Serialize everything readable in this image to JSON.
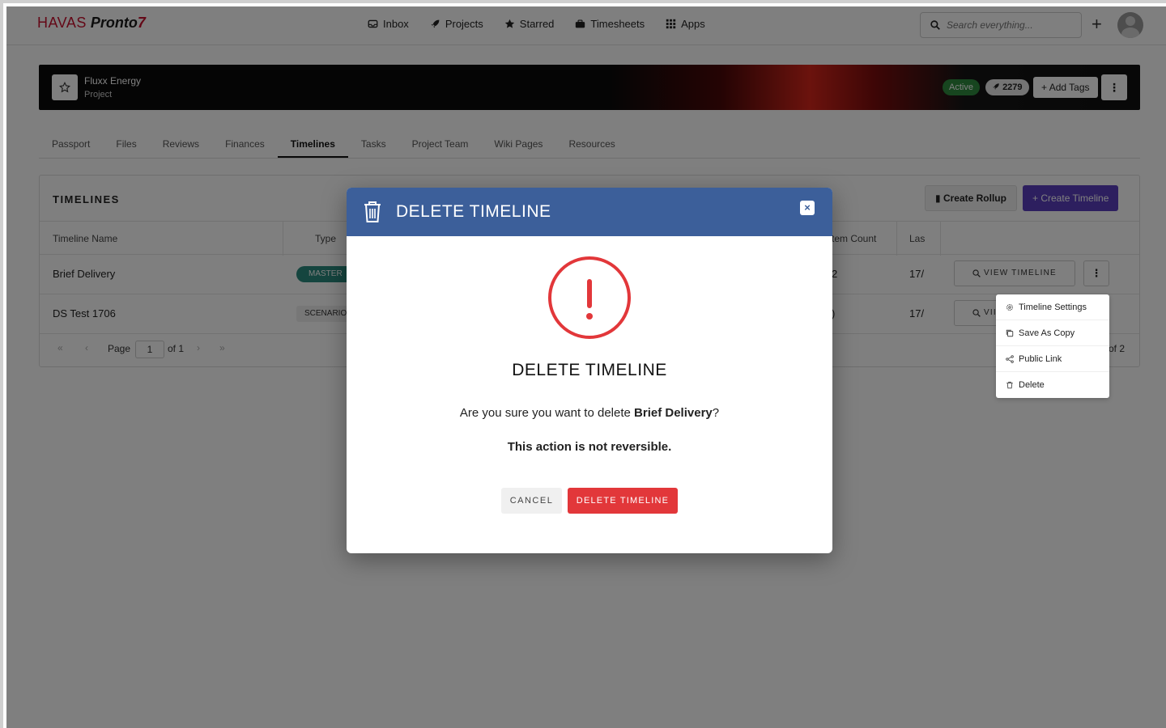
{
  "brand": {
    "havas": "HAVAS",
    "pronto": "Pronto",
    "bolt": "7"
  },
  "nav": {
    "items": [
      {
        "label": "Inbox",
        "icon": "inbox-icon"
      },
      {
        "label": "Projects",
        "icon": "rocket-icon"
      },
      {
        "label": "Starred",
        "icon": "star-icon"
      },
      {
        "label": "Timesheets",
        "icon": "briefcase-icon"
      },
      {
        "label": "Apps",
        "icon": "grid-icon"
      }
    ],
    "search_placeholder": "Search everything..."
  },
  "project": {
    "name": "Fluxx Energy",
    "type": "Project",
    "status": "Active",
    "id": "2279",
    "add_tags": "Add Tags"
  },
  "tabs": [
    "Passport",
    "Files",
    "Reviews",
    "Finances",
    "Timelines",
    "Tasks",
    "Project Team",
    "Wiki Pages",
    "Resources"
  ],
  "active_tab": "Timelines",
  "timelines": {
    "title": "TIMELINES",
    "create_rollup": "Create Rollup",
    "create_timeline": "Create Timeline",
    "columns": {
      "name": "Timeline Name",
      "type": "Type",
      "count": "tem Count",
      "last": "Las"
    },
    "rows": [
      {
        "name": "Brief Delivery",
        "type": "MASTER",
        "count": "2",
        "last": "17/",
        "action": "VIEW TIMELINE"
      },
      {
        "name": "DS Test 1706",
        "type": "SCENARIO",
        "count": ")",
        "last": "17/",
        "action": "VII"
      }
    ],
    "pager": {
      "page_label": "Page",
      "page": "1",
      "of": "of 1",
      "total": "of 2"
    }
  },
  "row_menu": {
    "items": [
      {
        "label": "Timeline Settings",
        "icon": "gear-icon"
      },
      {
        "label": "Save As Copy",
        "icon": "copy-icon"
      },
      {
        "label": "Public Link",
        "icon": "share-icon"
      },
      {
        "label": "Delete",
        "icon": "trash-icon"
      }
    ]
  },
  "modal": {
    "header_title": "DELETE TIMELINE",
    "heading": "DELETE TIMELINE",
    "message_prefix": "Are you sure you want to delete ",
    "message_target": "Brief Delivery",
    "message_suffix": "?",
    "warning": "This action is not reversible.",
    "cancel": "CANCEL",
    "confirm": "DELETE TIMELINE",
    "close": "×"
  },
  "colors": {
    "brand_red": "#c8102e",
    "modal_header": "#3c5f9a",
    "danger": "#e2373a",
    "primary_purple": "#5b3fbf",
    "active_green": "#2e8b3e",
    "master_teal": "#2b8a7e"
  }
}
